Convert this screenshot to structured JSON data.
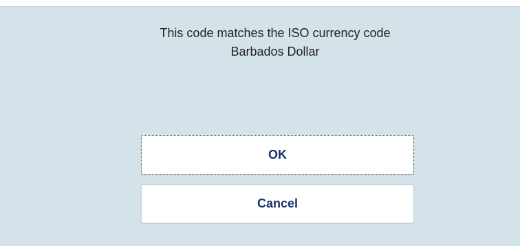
{
  "dialog": {
    "message_line1": "This code matches the ISO currency code",
    "message_line2": "Barbados Dollar",
    "ok_label": "OK",
    "cancel_label": "Cancel"
  },
  "colors": {
    "dialog_background": "#d4e2e9",
    "button_text": "#1a3270",
    "message_text": "#222222"
  }
}
